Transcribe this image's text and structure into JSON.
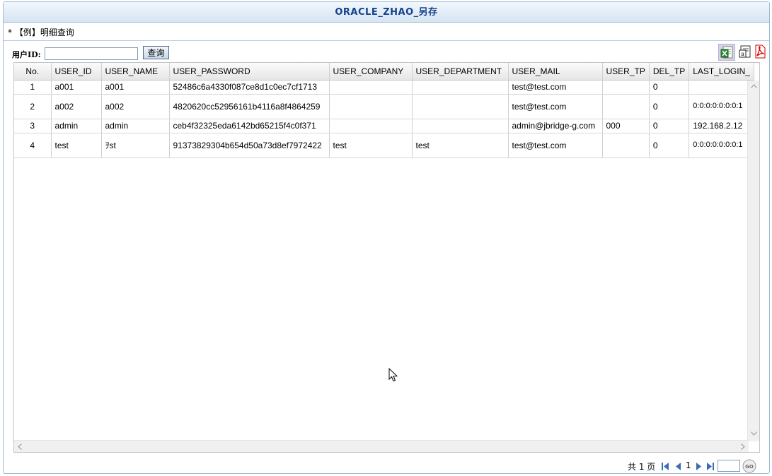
{
  "window": {
    "title": "ORACLE_ZHAO_另存"
  },
  "breadcrumb": "* 【例】明细查询",
  "search": {
    "label": "用户ID:",
    "value": "",
    "button_label": "查询"
  },
  "toolbar": {
    "icons": [
      "excel-export-icon",
      "word-export-icon",
      "pdf-export-icon"
    ]
  },
  "table": {
    "columns": [
      "No.",
      "USER_ID",
      "USER_NAME",
      "USER_PASSWORD",
      "USER_COMPANY",
      "USER_DEPARTMENT",
      "USER_MAIL",
      "USER_TP",
      "DEL_TP",
      "LAST_LOGIN_"
    ],
    "rows": [
      [
        "1",
        "a001",
        "a001",
        "52486c6a4330f087ce8d1c0ec7cf1713",
        "",
        "",
        "test@test.com",
        "",
        "0",
        ""
      ],
      [
        "2",
        "a002",
        "a002",
        "4820620cc52956161b4116a8f4864259",
        "",
        "",
        "test@test.com",
        "",
        "0",
        "0:0:0:0:0:0:0:1"
      ],
      [
        "3",
        "admin",
        "admin",
        "ceb4f32325eda6142bd65215f4c0f371",
        "",
        "",
        "admin@jbridge-g.com",
        "000",
        "0",
        "192.168.2.12"
      ],
      [
        "4",
        "test",
        "ｦst",
        "91373829304b654d50a73d8ef7972422",
        "test",
        "test",
        "test@test.com",
        "",
        "0",
        "0:0:0:0:0:0:0:1"
      ]
    ]
  },
  "pager": {
    "page_count": "共 1 页",
    "current_page": "1",
    "jump_value": "",
    "go_label": "GO"
  }
}
